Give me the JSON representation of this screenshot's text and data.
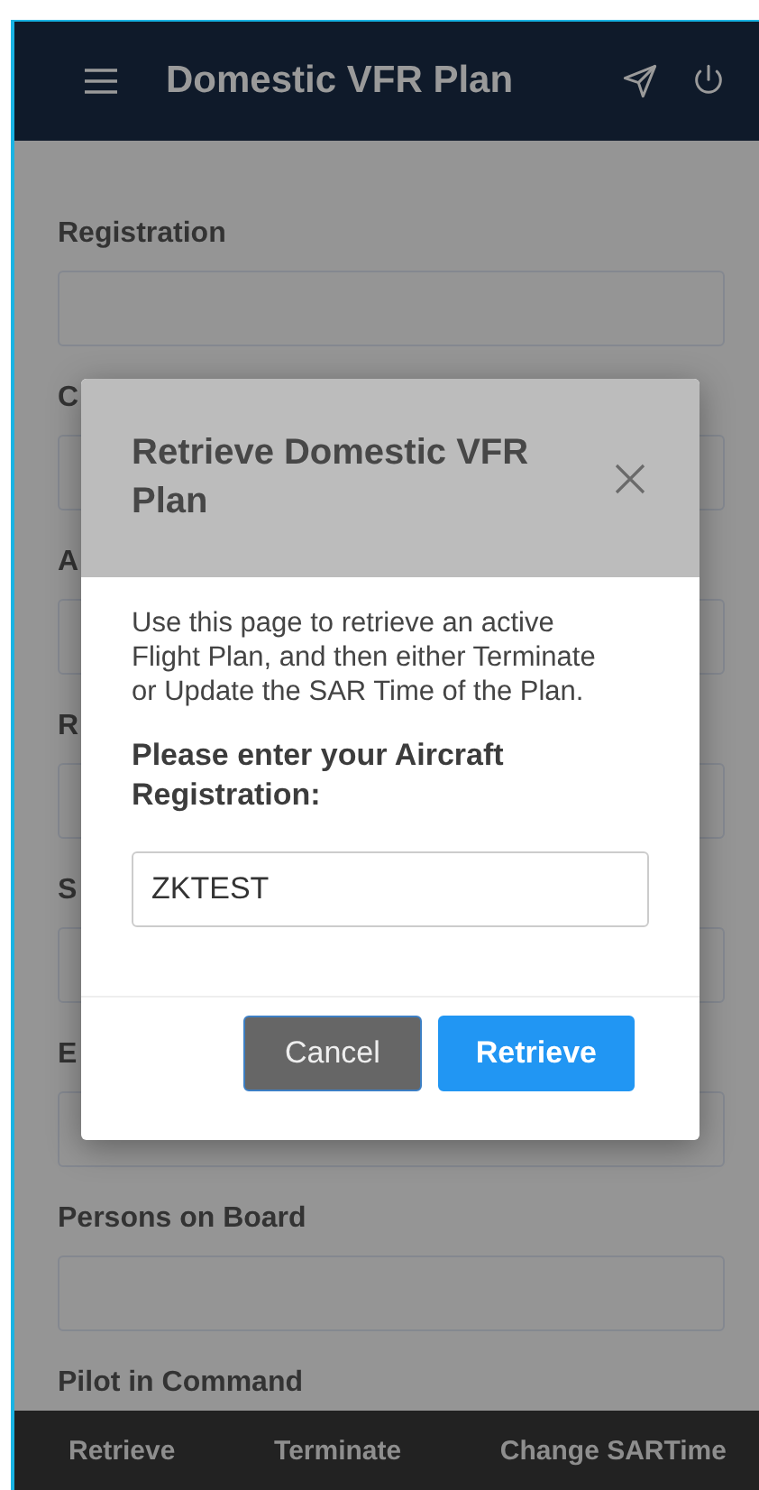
{
  "header": {
    "title": "Domestic VFR Plan"
  },
  "form": {
    "fields": [
      {
        "label": "Registration"
      },
      {
        "label": "C"
      },
      {
        "label": "A"
      },
      {
        "label": "R"
      },
      {
        "label": "S"
      },
      {
        "label": "E"
      },
      {
        "label": "Persons on Board"
      },
      {
        "label": "Pilot in Command"
      }
    ]
  },
  "modal": {
    "title": "Retrieve Domestic VFR Plan",
    "description": "Use this page to retrieve an active Flight Plan, and then either Terminate or Update the SAR Time of the Plan.",
    "field_label": "Please enter your Aircraft Registration:",
    "input_value": "ZKTEST",
    "buttons": [
      {
        "label": "Cancel",
        "kind": "secondary"
      },
      {
        "label": "Retrieve",
        "kind": "primary"
      }
    ]
  },
  "bottom_bar": {
    "items": [
      {
        "label": "Retrieve"
      },
      {
        "label": "Terminate"
      },
      {
        "label": "Change SARTime"
      }
    ]
  }
}
